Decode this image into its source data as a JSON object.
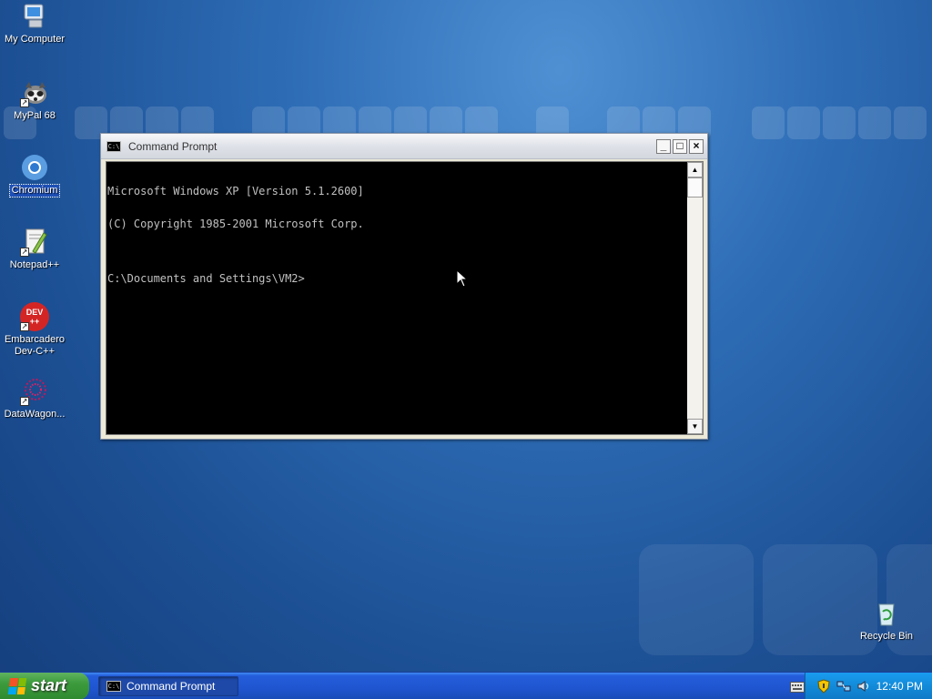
{
  "desktop": {
    "icons": [
      {
        "label": "My Computer"
      },
      {
        "label": "MyPal 68"
      },
      {
        "label": "Chromium"
      },
      {
        "label": "Notepad++"
      },
      {
        "label": "Embarcadero Dev-C++"
      },
      {
        "label": "DataWagon..."
      },
      {
        "label": "Recycle Bin"
      }
    ],
    "devcpp_badge": "DEV\n++"
  },
  "window": {
    "title": "Command Prompt",
    "title_icon": "C:\\",
    "buttons": {
      "minimize": "_",
      "maximize": "□",
      "close": "×"
    },
    "console_lines": [
      "Microsoft Windows XP [Version 5.1.2600]",
      "(C) Copyright 1985-2001 Microsoft Corp.",
      "",
      "C:\\Documents and Settings\\VM2>"
    ]
  },
  "taskbar": {
    "start_label": "start",
    "task_button_label": "Command Prompt",
    "clock": "12:40 PM"
  },
  "colors": {
    "desktop_bg": "#2d6cb5",
    "taskbar": "#245ddb",
    "tray": "#128ad8",
    "start": "#3c9a3c"
  }
}
